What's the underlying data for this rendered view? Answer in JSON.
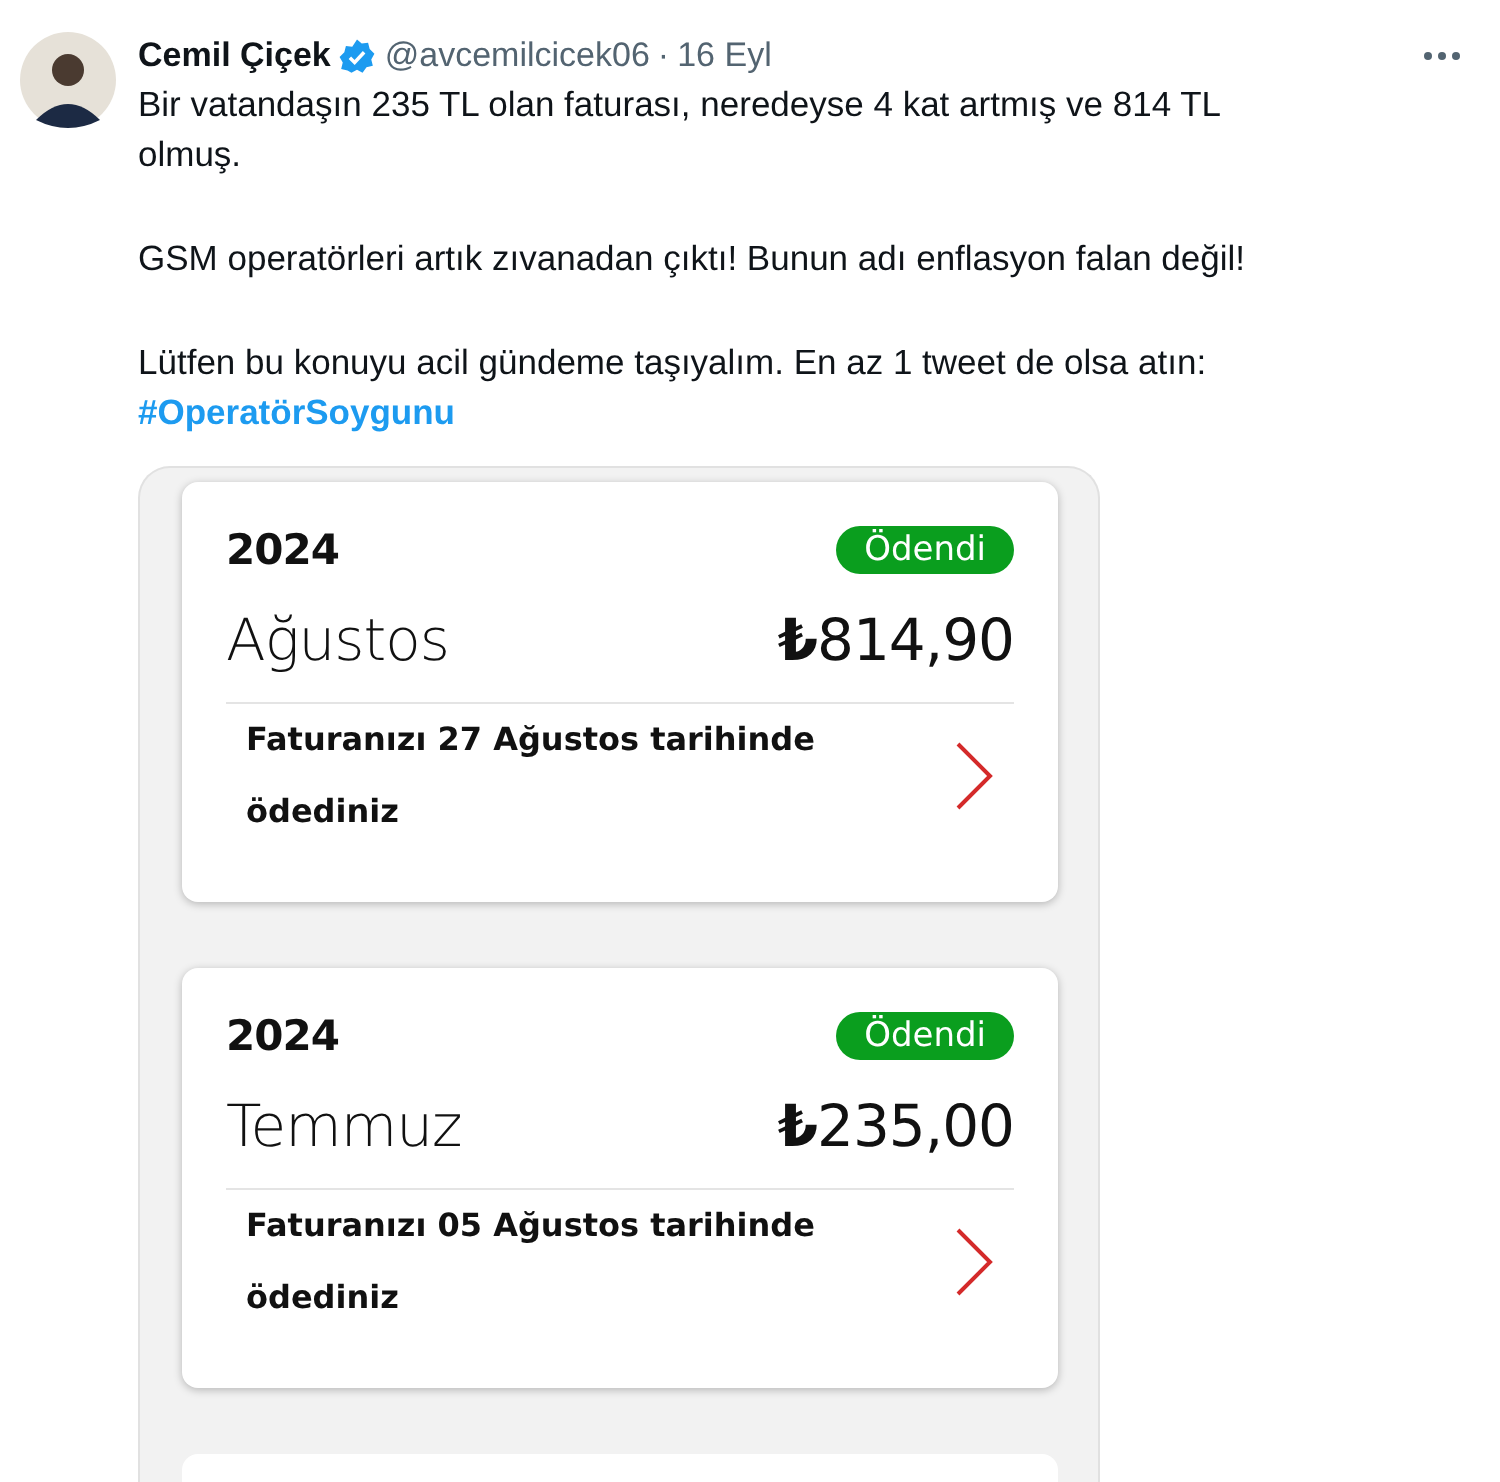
{
  "tweet": {
    "author": "Cemil Çiçek",
    "verified": true,
    "handle": "@avcemilcicek06",
    "separator": "·",
    "date": "16 Eyl",
    "paragraphs": [
      "Bir vatandaşın 235 TL olan faturası, neredeyse 4 kat artmış ve 814 TL olmuş.",
      "GSM operatörleri artık zıvanadan çıktı! Bunun adı enflasyon falan değil!",
      "Lütfen bu konuyu acil gündeme taşıyalım. En az 1 tweet de olsa atın:"
    ],
    "hashtag": "#OperatörSoygunu",
    "attachment": {
      "bills": [
        {
          "year": "2024",
          "status": "Ödendi",
          "month": "Ağustos",
          "amount": "**₺**814,90",
          "note": "Faturanızı 27 Ağustos tarihinde ödediniz"
        },
        {
          "year": "2024",
          "status": "Ödendi",
          "month": "Temmuz",
          "amount": "**₺**235,00",
          "note": "Faturanızı 05 Ağustos tarihinde ödediniz"
        }
      ]
    }
  }
}
